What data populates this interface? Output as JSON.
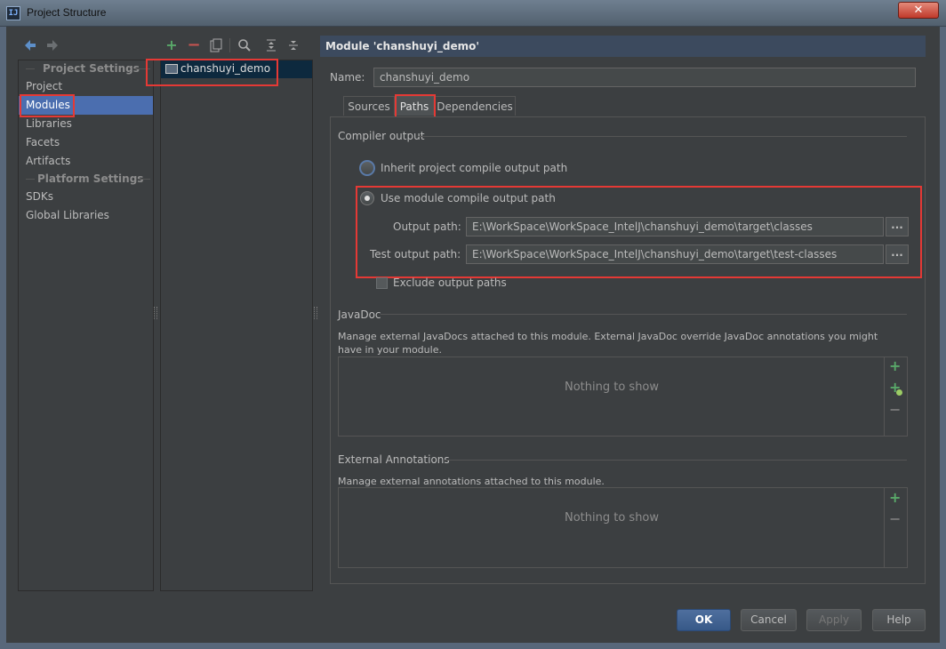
{
  "window": {
    "title": "Project Structure",
    "close_glyph": "✕",
    "app_icon_text": "IJ"
  },
  "toolbar": {
    "back_icon": "arrow-left-icon",
    "forward_icon": "arrow-right-icon",
    "add_icon": "plus-icon",
    "remove_icon": "minus-icon",
    "copy_icon": "copy-icon",
    "find_icon": "search-icon",
    "expand_icon": "expand-all-icon",
    "collapse_icon": "collapse-all-icon"
  },
  "nav": {
    "project_settings_header": "Project Settings",
    "platform_settings_header": "Platform Settings",
    "items": [
      {
        "label": "Project"
      },
      {
        "label": "Modules"
      },
      {
        "label": "Libraries"
      },
      {
        "label": "Facets"
      },
      {
        "label": "Artifacts"
      }
    ],
    "platform_items": [
      {
        "label": "SDKs"
      },
      {
        "label": "Global Libraries"
      }
    ]
  },
  "modules": {
    "items": [
      {
        "label": "chanshuyi_demo"
      }
    ]
  },
  "module_panel": {
    "header": "Module 'chanshuyi_demo'",
    "name_label": "Name:",
    "name_value": "chanshuyi_demo",
    "tabs": [
      {
        "label": "Sources"
      },
      {
        "label": "Paths"
      },
      {
        "label": "Dependencies"
      }
    ],
    "active_tab": "Paths"
  },
  "compiler_output": {
    "section": "Compiler output",
    "inherit_label": "Inherit project compile output path",
    "use_module_label": "Use module compile output path",
    "output_path_label": "Output path:",
    "output_path_value": "E:\\WorkSpace\\WorkSpace_IntelJ\\chanshuyi_demo\\target\\classes",
    "test_output_path_label": "Test output path:",
    "test_output_path_value": "E:\\WorkSpace\\WorkSpace_IntelJ\\chanshuyi_demo\\target\\test-classes",
    "browse_label": "...",
    "exclude_label": "Exclude output paths",
    "selected": "use_module"
  },
  "javadoc": {
    "section": "JavaDoc",
    "description": "Manage external JavaDocs attached to this module. External JavaDoc override JavaDoc annotations you might have in your module.",
    "empty_text": "Nothing to show"
  },
  "external_annotations": {
    "section": "External Annotations",
    "description": "Manage external annotations attached to this module.",
    "empty_text": "Nothing to show"
  },
  "buttons": {
    "ok": "OK",
    "cancel": "Cancel",
    "apply": "Apply",
    "help": "Help"
  },
  "colors": {
    "background": "#3c3f41",
    "selection": "#4b6eaf",
    "highlight_box": "#e53935",
    "add_green": "#59a869"
  }
}
